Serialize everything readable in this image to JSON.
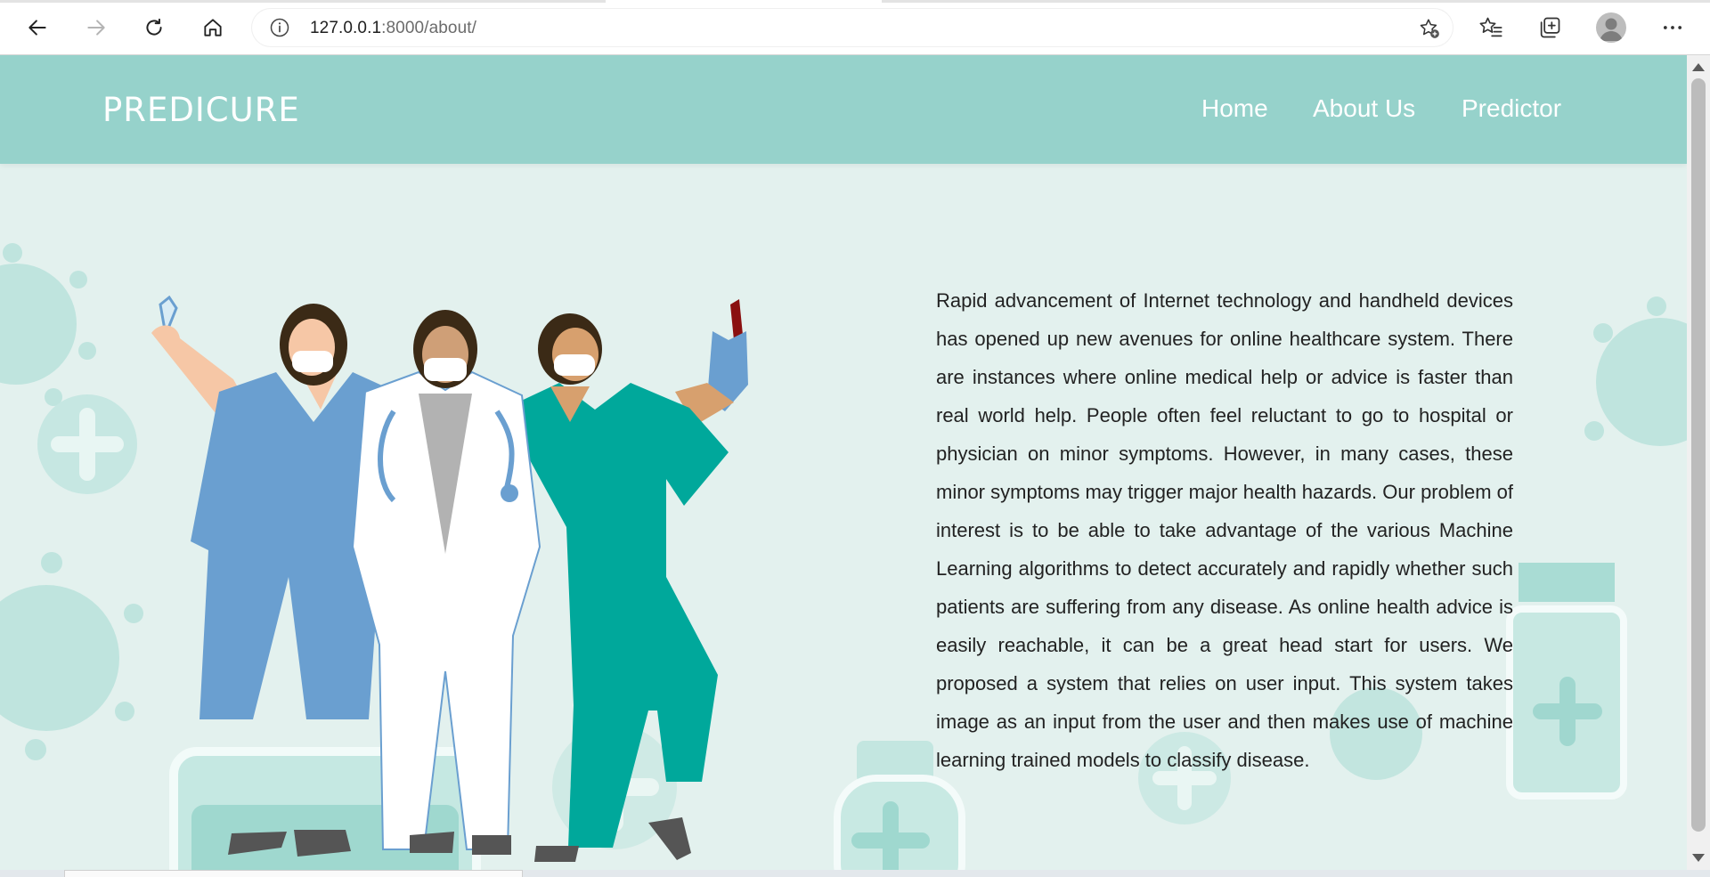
{
  "browser": {
    "url_host": "127.0.0.1",
    "url_path": ":8000/about/",
    "icons": [
      "back-icon",
      "forward-icon",
      "refresh-icon",
      "home-icon",
      "info-icon",
      "favorite-add-icon",
      "favorites-icon",
      "collections-icon",
      "profile-icon",
      "more-icon"
    ]
  },
  "site": {
    "brand": "PREDICURE",
    "nav": [
      {
        "label": "Home"
      },
      {
        "label": "About Us"
      },
      {
        "label": "Predictor"
      }
    ]
  },
  "about": {
    "paragraph": "Rapid advancement of Internet technology and handheld devices has opened up new avenues for online healthcare system. There are instances where online medical help or advice is faster than real world help. People often feel reluctant to go to hospital or physician on minor symptoms. However, in many cases, these minor symptoms may trigger major health hazards. Our problem of interest is to be able to take advantage of the various Machine Learning algorithms to detect accurately and rapidly whether such patients are suffering from any disease. As online health advice is easily reachable, it can be a great head start for users. We proposed a system that relies on user input. This system takes image as an input from the user and then makes use of machine learning trained models to classify disease."
  },
  "colors": {
    "header": "#96d2cb",
    "page_bg": "#e3f1ee",
    "accent": "#9ed7cf",
    "scrub_blue": "#6a9fd0",
    "scrub_green": "#00a89b"
  }
}
